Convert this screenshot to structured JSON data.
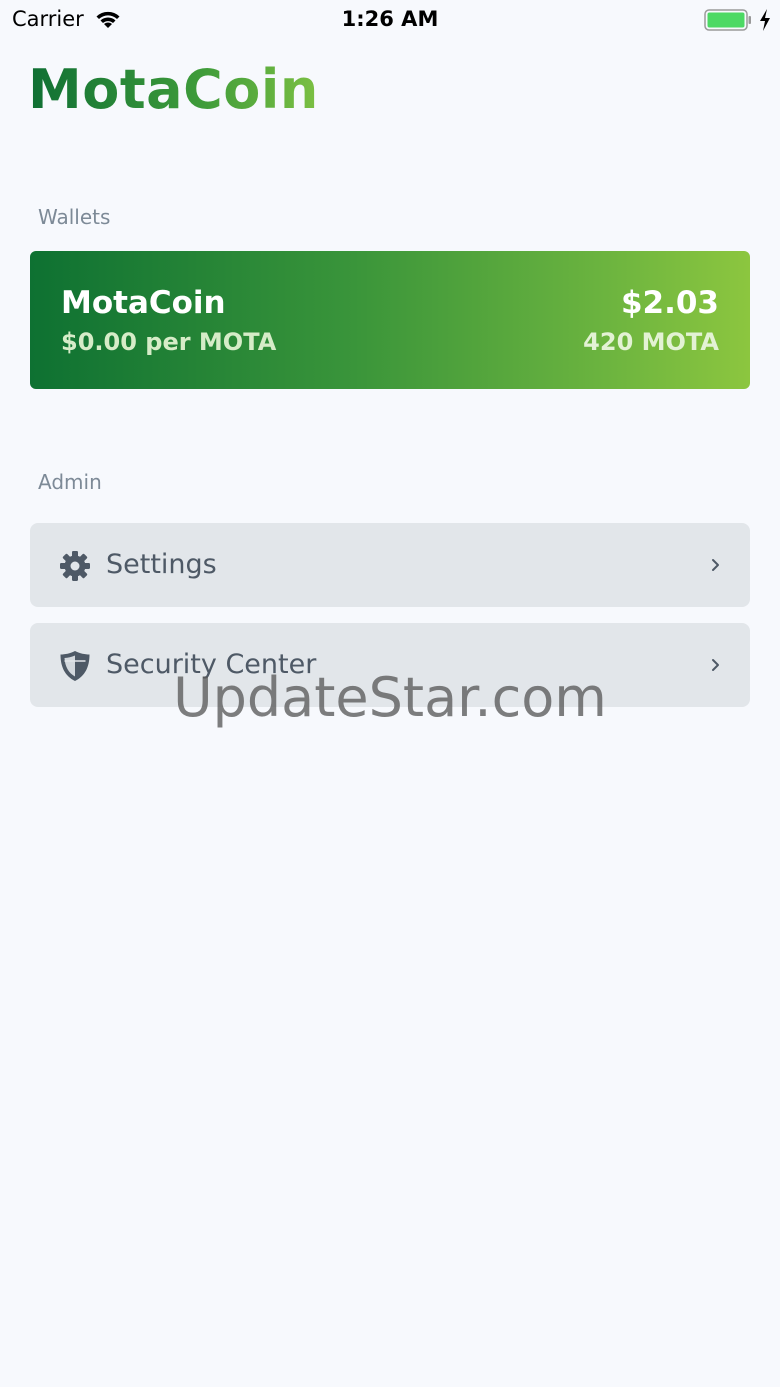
{
  "status_bar": {
    "carrier": "Carrier",
    "time": "1:26 AM",
    "wifi_icon": "wifi-icon",
    "battery_icon": "battery-icon",
    "charging_icon": "charging-bolt-icon"
  },
  "app": {
    "logo_text": "MotaCoin",
    "colors": {
      "brand_dark": "#0f6f34",
      "brand_light": "#8cc63f",
      "background": "#f7f9fd",
      "row_background": "#e2e6ea"
    }
  },
  "wallets": {
    "section_label": "Wallets",
    "items": [
      {
        "name": "MotaCoin",
        "rate": "$0.00 per MOTA",
        "balance_fiat": "$2.03",
        "balance_coin": "420 MOTA"
      }
    ]
  },
  "admin": {
    "section_label": "Admin",
    "items": [
      {
        "label": "Settings",
        "icon": "gear-icon"
      },
      {
        "label": "Security Center",
        "icon": "shield-icon"
      }
    ]
  },
  "watermark": {
    "text": "UpdateStar.com"
  }
}
